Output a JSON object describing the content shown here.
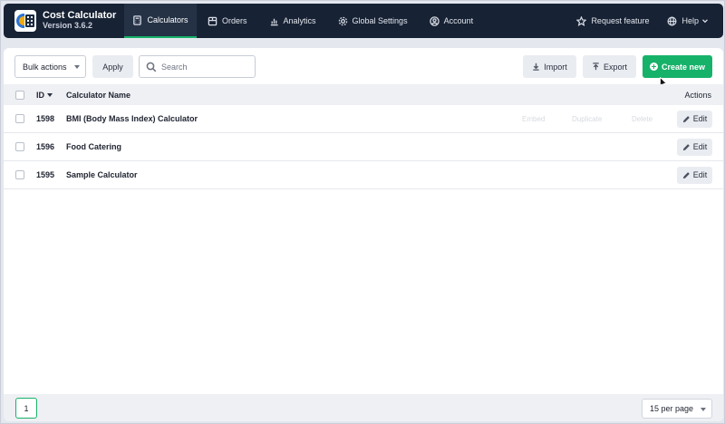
{
  "app": {
    "title": "Cost Calculator",
    "version": "Version 3.6.2"
  },
  "nav": {
    "items": [
      {
        "label": "Calculators",
        "icon": "calculator-icon",
        "active": true
      },
      {
        "label": "Orders",
        "icon": "orders-icon"
      },
      {
        "label": "Analytics",
        "icon": "analytics-icon"
      },
      {
        "label": "Global Settings",
        "icon": "gear-icon"
      },
      {
        "label": "Account",
        "icon": "user-icon"
      }
    ],
    "request_feature": "Request feature",
    "help": "Help"
  },
  "toolbar": {
    "bulk_actions": "Bulk actions",
    "apply": "Apply",
    "search_placeholder": "Search",
    "import": "Import",
    "export": "Export",
    "create_new": "Create new"
  },
  "table": {
    "columns": {
      "id": "ID",
      "name": "Calculator Name",
      "actions": "Actions"
    },
    "rows": [
      {
        "id": "1598",
        "name": "BMI (Body Mass Index) Calculator"
      },
      {
        "id": "1596",
        "name": "Food Catering"
      },
      {
        "id": "1595",
        "name": "Sample Calculator"
      }
    ],
    "row_actions": {
      "ghost1": "Embed",
      "ghost2": "Duplicate",
      "ghost3": "Delete",
      "edit": "Edit"
    }
  },
  "footer": {
    "page": "1",
    "per_page": "15 per page"
  },
  "colors": {
    "nav_bg": "#172234",
    "accent": "#17b26a"
  }
}
